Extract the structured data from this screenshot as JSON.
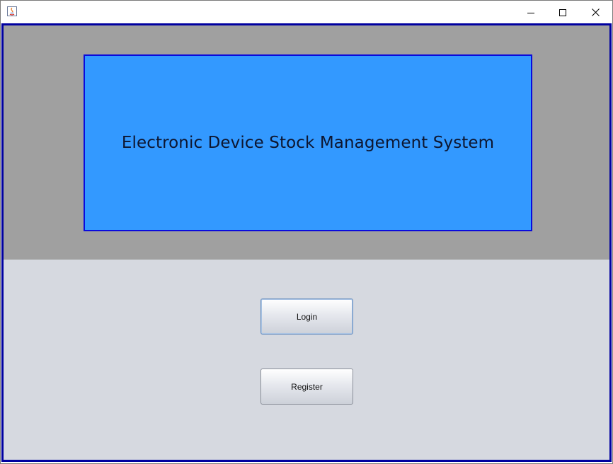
{
  "window": {
    "controls": {
      "minimize_icon": "minimize-icon",
      "maximize_icon": "maximize-icon",
      "close_icon": "close-icon"
    },
    "app_icon": "java-app-icon"
  },
  "banner": {
    "title": "Electronic Device Stock Management System",
    "background_color": "#3399ff",
    "border_color": "#0a0adc"
  },
  "buttons": {
    "login_label": "Login",
    "register_label": "Register"
  },
  "colors": {
    "frame_border": "#0000a0",
    "top_panel": "#a0a0a0",
    "bottom_panel": "#d6d9e0"
  }
}
